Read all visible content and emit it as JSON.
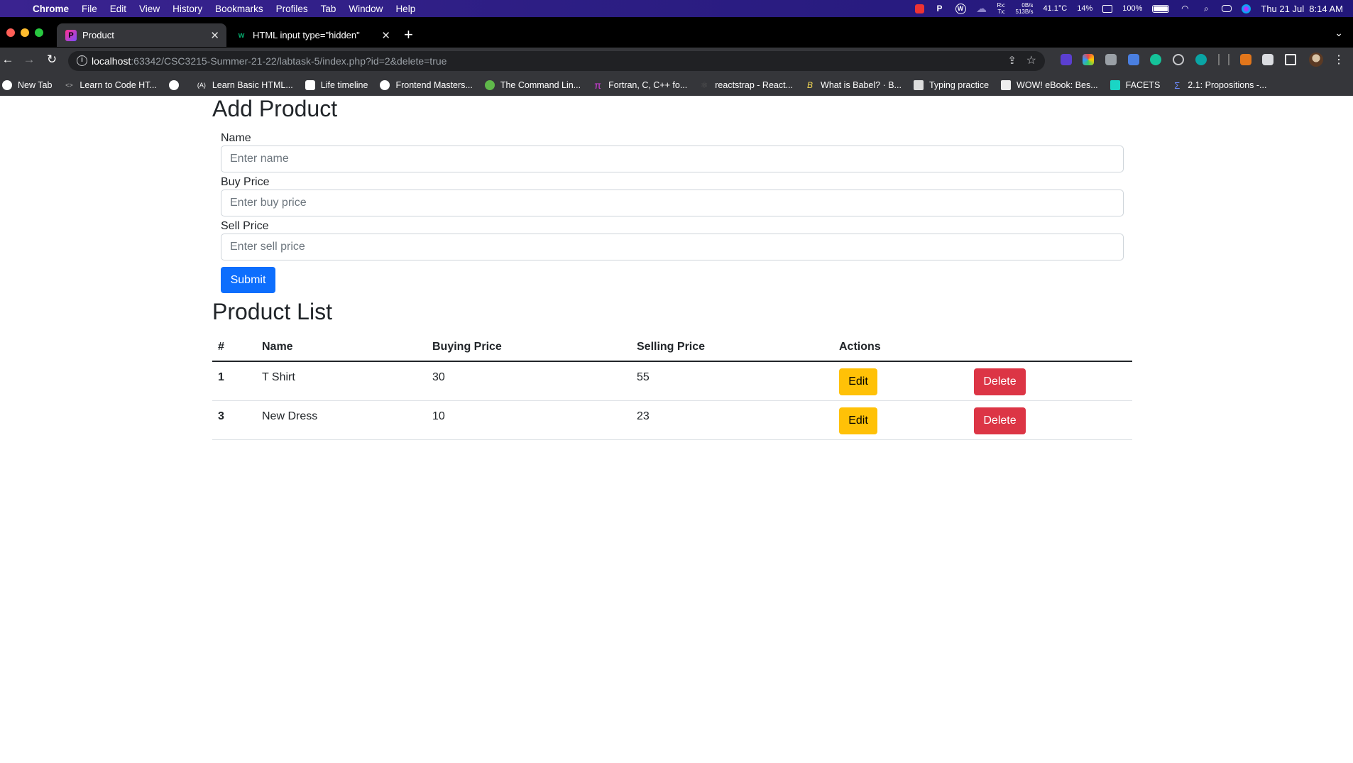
{
  "menubar": {
    "app": "Chrome",
    "items": [
      "File",
      "Edit",
      "View",
      "History",
      "Bookmarks",
      "Profiles",
      "Tab",
      "Window",
      "Help"
    ],
    "net_rx_label": "Rx:",
    "net_tx_label": "Tx:",
    "net_rx": "0B/s",
    "net_tx": "513B/s",
    "temp": "41.1°C",
    "cpu": "14%",
    "battery": "100%",
    "datetime": "Thu 21 Jul  8:14 AM"
  },
  "tabs": [
    {
      "title": "Product",
      "active": true
    },
    {
      "title": "HTML input type=\"hidden\"",
      "active": false
    }
  ],
  "address": {
    "host": "localhost",
    "path": ":63342/CSC3215-Summer-21-22/labtask-5/index.php?id=2&delete=true"
  },
  "bookmarks": [
    "New Tab",
    "Learn to Code HT...",
    "",
    "Learn Basic HTML...",
    "Life timeline",
    "Frontend Masters...",
    "The Command Lin...",
    "Fortran, C, C++ fo...",
    "reactstrap - React...",
    "What is Babel? · B...",
    "Typing practice",
    "WOW! eBook: Bes...",
    "FACETS",
    "2.1: Propositions -..."
  ],
  "page": {
    "add_title": "Add Product",
    "fields": [
      {
        "label": "Name",
        "placeholder": "Enter name"
      },
      {
        "label": "Buy Price",
        "placeholder": "Enter buy price"
      },
      {
        "label": "Sell Price",
        "placeholder": "Enter sell price"
      }
    ],
    "submit_label": "Submit",
    "list_title": "Product List",
    "columns": [
      "#",
      "Name",
      "Buying Price",
      "Selling Price",
      "Actions"
    ],
    "rows": [
      {
        "id": "1",
        "name": "T Shirt",
        "buy": "30",
        "sell": "55"
      },
      {
        "id": "3",
        "name": "New Dress",
        "buy": "10",
        "sell": "23"
      }
    ],
    "edit_label": "Edit",
    "delete_label": "Delete"
  },
  "colors": {
    "primary": "#0d6efd",
    "warning": "#ffc107",
    "danger": "#dc3545"
  }
}
